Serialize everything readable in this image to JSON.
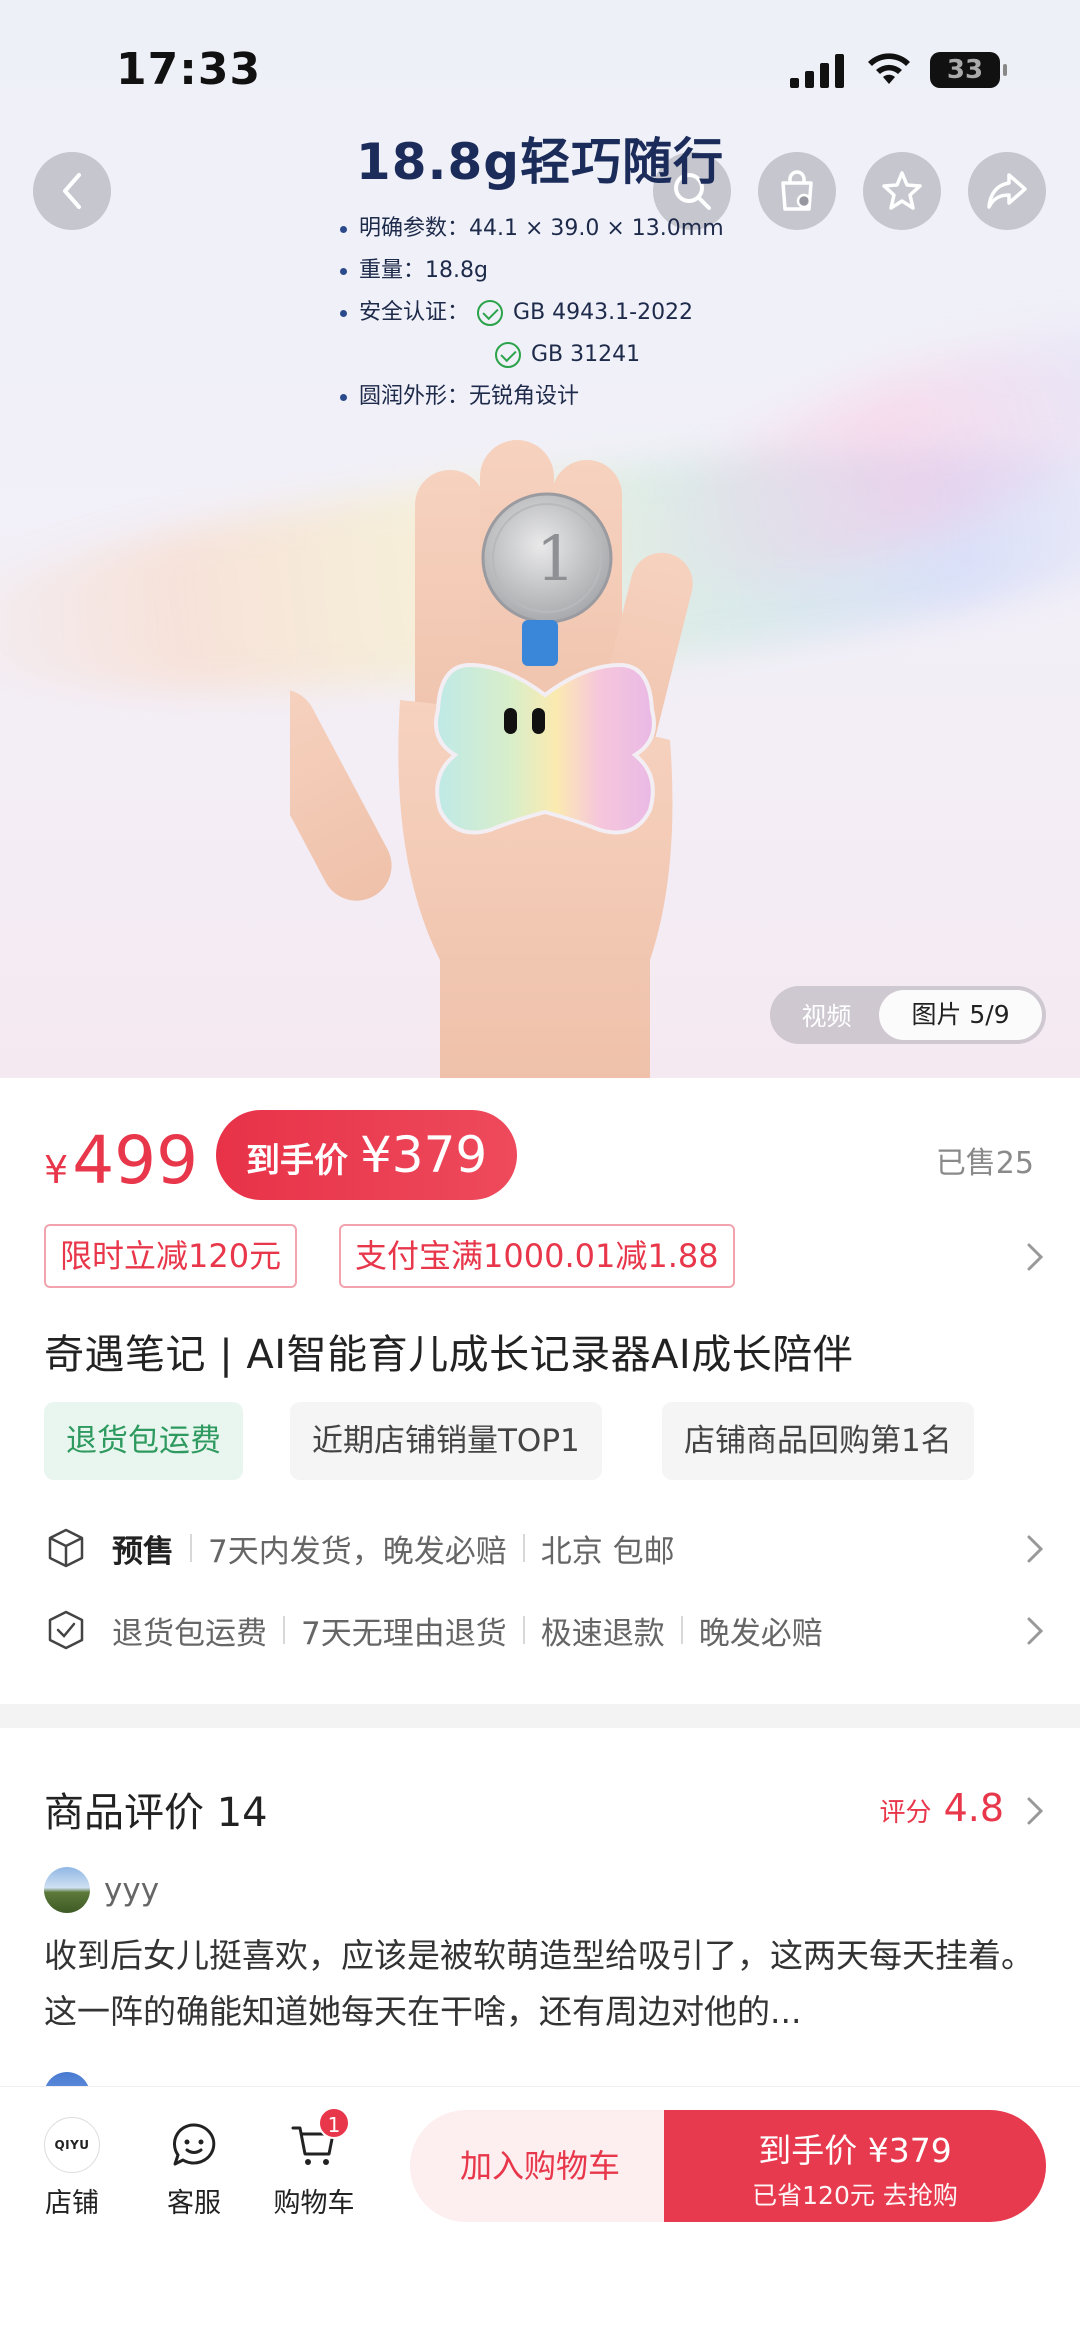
{
  "status_bar": {
    "time": "17:33",
    "battery": "33"
  },
  "hero": {
    "spec_title": "18.8g轻巧随行",
    "specs": {
      "size": "明确参数：44.1 × 39.0 × 13.0mm",
      "weight": "重量：18.8g",
      "cert_label": "安全认证：",
      "cert_1": "GB 4943.1-2022",
      "cert_2": "GB 31241",
      "shape": "圆润外形：无锐角设计"
    },
    "media_toggle": {
      "video": "视频",
      "images": "图片 5/9"
    }
  },
  "price": {
    "currency": "¥",
    "original": "499",
    "final_label": "到手价",
    "final_amount": "¥379",
    "sold": "已售25"
  },
  "coupons": [
    "限时立减120元",
    "支付宝满1000.01减1.88"
  ],
  "product_title": "奇遇笔记 | AI智能育儿成长记录器AI成长陪伴",
  "tags": [
    "退货包运费",
    "近期店铺销量TOP1",
    "店铺商品回购第1名"
  ],
  "shipping": {
    "presale": "预售",
    "delivery": "7天内发货，晚发必赔",
    "origin": "北京 包邮"
  },
  "guarantees": [
    "退货包运费",
    "7天无理由退货",
    "极速退款",
    "晚发必赔"
  ],
  "reviews": {
    "title": "商品评价 14",
    "score_label": "评分",
    "score": "4.8",
    "first": {
      "user": "yyy",
      "text": "收到后女儿挺喜欢，应该是被软萌造型给吸引了，这两天每天挂着。这一阵的确能知道她每天在干啥，还有周边对他的..."
    }
  },
  "bottom_bar": {
    "shop_logo": "QIYU",
    "shop": "店铺",
    "service": "客服",
    "cart": "购物车",
    "cart_count": "1",
    "add_to_cart": "加入购物车",
    "buy_line1": "到手价 ¥379",
    "buy_line2": "已省120元 去抢购"
  },
  "colors": {
    "accent": "#e8364a",
    "green_tag": "#2f9a5f"
  }
}
